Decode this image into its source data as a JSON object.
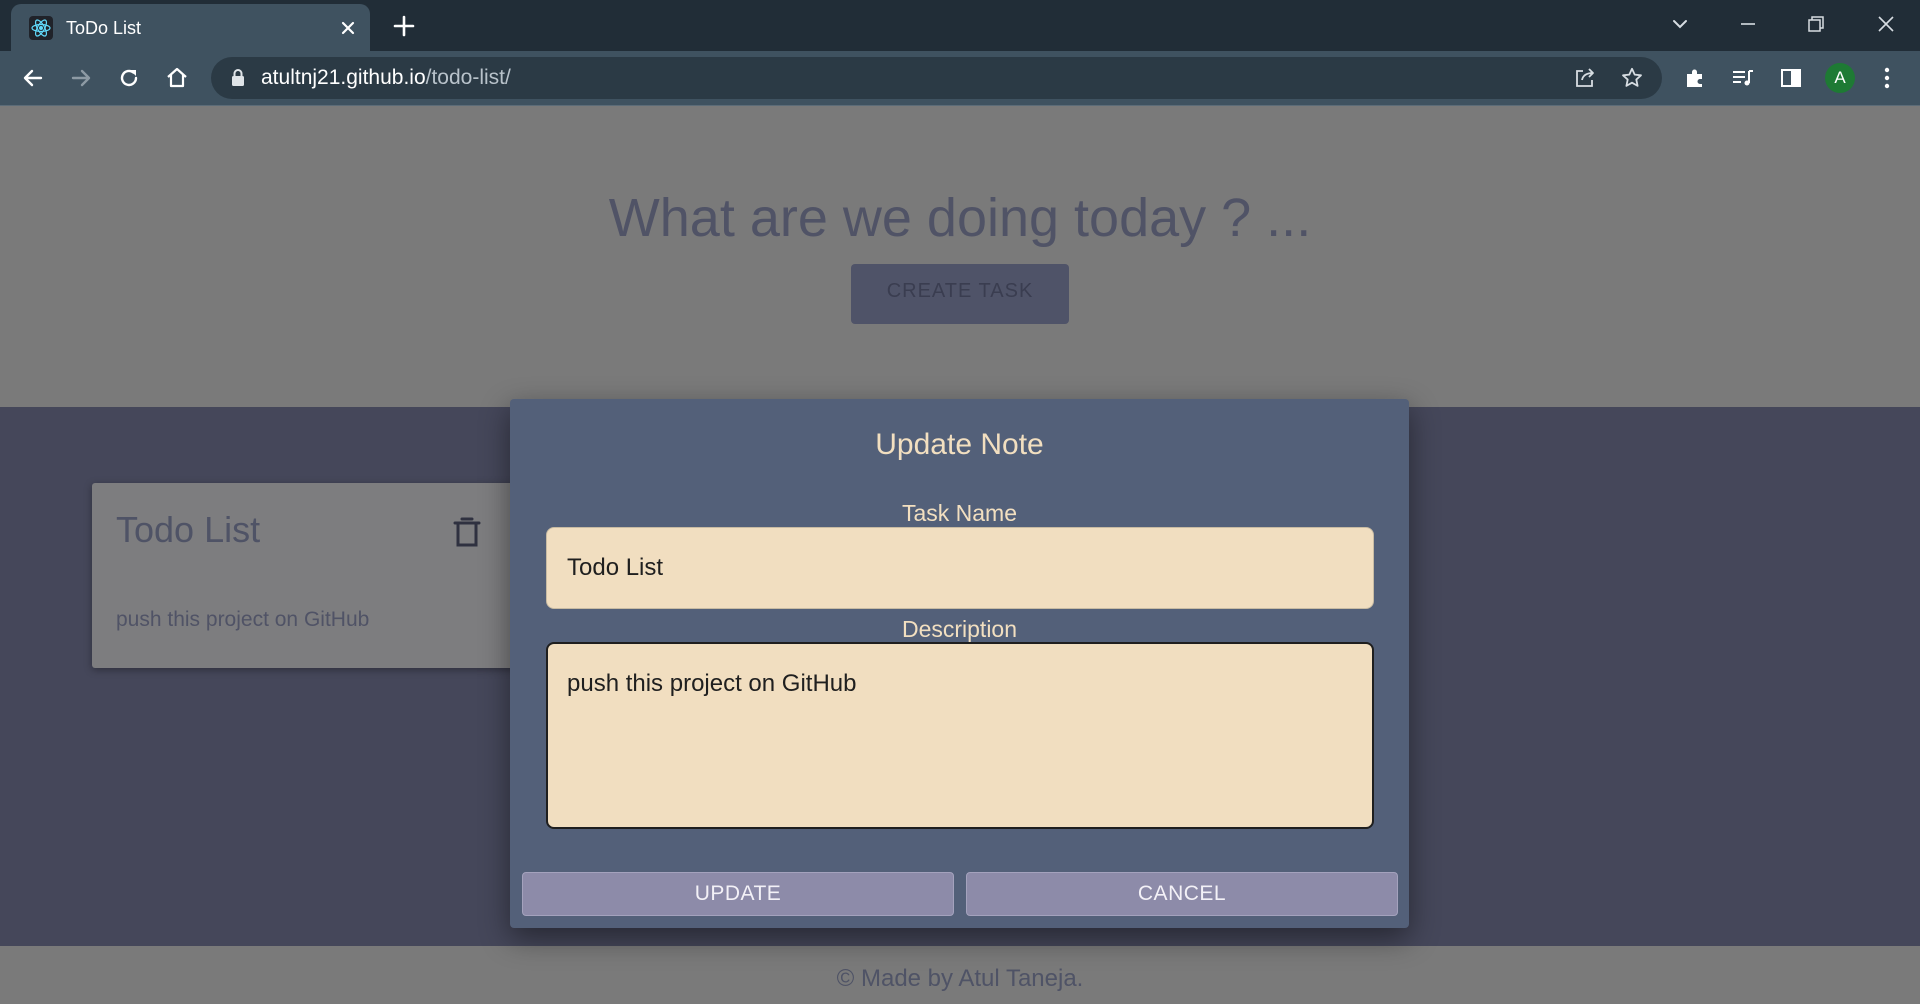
{
  "browser": {
    "tab_title": "ToDo List",
    "url_host": "atultnj21.github.io",
    "url_path": "/todo-list/",
    "profile_initial": "A",
    "icons": [
      "react-favicon-icon",
      "close-icon",
      "plus-icon",
      "chevron-down-icon",
      "minimize-icon",
      "restore-icon",
      "window-close-icon",
      "back-icon",
      "forward-icon",
      "reload-icon",
      "home-icon",
      "lock-icon",
      "share-icon",
      "star-icon",
      "extensions-icon",
      "media-icon",
      "side-panel-icon",
      "more-icon"
    ]
  },
  "page": {
    "heading": "What are we doing today ? ...",
    "create_button_label": "CREATE TASK",
    "card": {
      "title": "Todo List",
      "description": "push this project on GitHub"
    },
    "footer": "© Made by Atul Taneja."
  },
  "modal": {
    "title": "Update Note",
    "task_name_label": "Task Name",
    "task_name_value": "Todo List",
    "description_label": "Description",
    "description_value": "push this project on GitHub",
    "update_label": "UPDATE",
    "cancel_label": "CANCEL"
  },
  "colors": {
    "overlay_gray": "#7a7a7a",
    "main_bg": "#45475a",
    "modal_bg": "#536079",
    "input_bg": "#f1dec0",
    "button_bg": "#8d8ba9",
    "modal_text": "#f2dfc0"
  }
}
